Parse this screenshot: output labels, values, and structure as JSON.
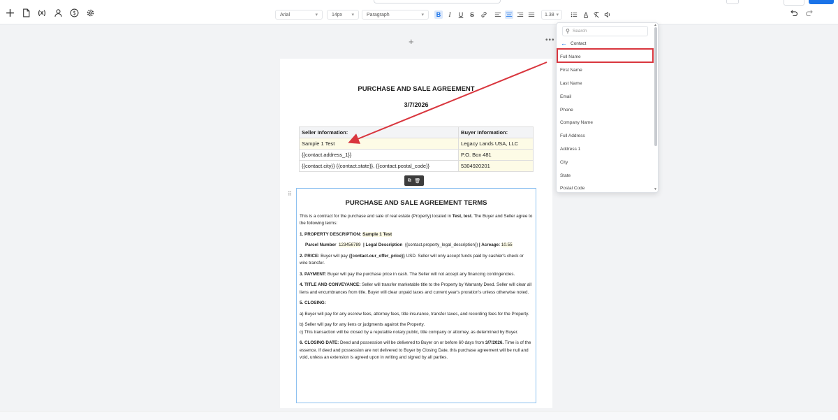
{
  "toolbar": {
    "font_family": "Arial",
    "font_size": "14px",
    "block_type": "Paragraph",
    "line_height": "1.38"
  },
  "document": {
    "title": "PURCHASE AND SALE AGREEMENT",
    "date": "3/7/2026",
    "table": {
      "headers": [
        "Seller Information:",
        "Buyer Information:"
      ],
      "rows": [
        [
          "Sample 1 Test",
          "Legacy Lands USA, LLC"
        ],
        [
          "{{contact.address_1}}",
          "P.O. Box 481"
        ],
        [
          "{{contact.city}} {{contact.state}}, {{contact.postal_code}}",
          "5304920201"
        ]
      ]
    },
    "terms": {
      "title": "PURCHASE AND SALE AGREEMENT TERMS",
      "intro_a": "This is a contract for the purchase and sale of real estate (Property) located in ",
      "intro_loc": "Test, test.",
      "intro_b": " The Buyer and Seller agree to the following terms:",
      "s1_label": "1. PROPERTY DESCRIPTION: ",
      "s1_value": "Sample 1 Test",
      "parcel_label": "Parcel Number",
      "parcel_value": "123456789",
      "legal_label": "| Legal Description",
      "legal_value": "{{contact.property_legal_description}}",
      "acreage_label": "| Acreage:",
      "acreage_value": "10.55",
      "s2_label": "2. PRICE:",
      "s2_a": " Buyer will pay ",
      "s2_var": "{{contact.our_offer_price}}",
      "s2_b": " USD. Seller will only accept funds paid by cashier's check or wire transfer.",
      "s3_label": "3. PAYMENT:",
      "s3_text": " Buyer will pay the purchase price in cash. The Seller will not accept any financing contingencies.",
      "s4_label": "4. TITLE AND CONVEYANCE:",
      "s4_text": " Seller will transfer marketable title to the Property by Warranty Deed. Seller will clear all liens and encumbrances from title. Buyer will clear unpaid taxes and current year's proration's unless otherwise noted.",
      "s5_label": "5. CLOSING:",
      "s5_a": "a) Buyer will pay for any escrow fees, attorney fees, title insurance, transfer taxes, and recording fees for the Property.",
      "s5_b": "b) Seller will pay for any liens or judgments against the Property.",
      "s5_c": "c) This transaction will be closed by a reputable notary public, title company or attorney, as determined by Buyer.",
      "s6_label": "6. CLOSING DATE:",
      "s6_a": " Deed and possession will be delivered to Buyer on or before 60 days from ",
      "s6_date": "3/7/2026.",
      "s6_b": "  Time is of the essence.  If deed and possession are not delivered to Buyer by Closing Date, this purchase agreement will be null and void, unless an extension is agreed upon in writing and signed by all parties."
    }
  },
  "dropdown": {
    "search_placeholder": "Search",
    "back_label": "Contact",
    "items": [
      "Full Name",
      "First Name",
      "Last Name",
      "Email",
      "Phone",
      "Company Name",
      "Full Address",
      "Address 1",
      "City",
      "State",
      "Postal Code"
    ]
  },
  "colors": {
    "accent": "#1a73e8",
    "annotation": "#d9363e",
    "selection_border": "#8ec1f0"
  }
}
